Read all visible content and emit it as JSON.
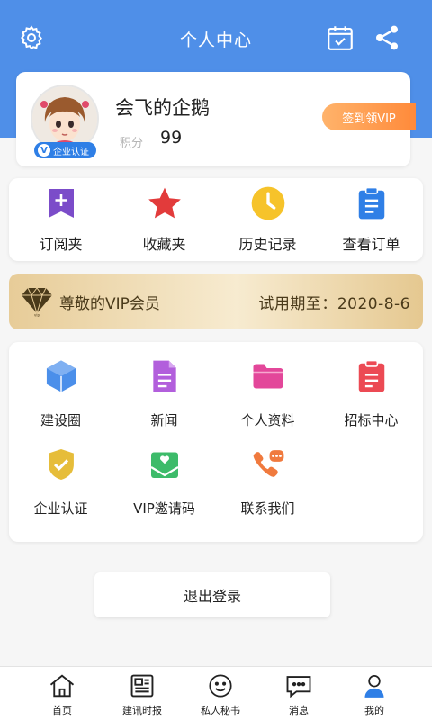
{
  "header": {
    "title": "个人中心"
  },
  "profile": {
    "name": "会飞的企鹅",
    "badge": "企业认证",
    "badge_mark": "V",
    "points_label": "积分",
    "points": "99",
    "signin": "签到领VIP"
  },
  "quick_actions": [
    {
      "label": "订阅夹",
      "icon": "subscribe-icon"
    },
    {
      "label": "收藏夹",
      "icon": "star-icon"
    },
    {
      "label": "历史记录",
      "icon": "clock-icon"
    },
    {
      "label": "查看订单",
      "icon": "clipboard-icon"
    }
  ],
  "vip": {
    "label": "尊敬的VIP会员",
    "expiry": "试用期至：2020-8-6",
    "logo_text": "vip"
  },
  "services": [
    {
      "label": "建设圈",
      "icon": "cube-icon"
    },
    {
      "label": "新闻",
      "icon": "document-icon"
    },
    {
      "label": "个人资料",
      "icon": "folder-icon"
    },
    {
      "label": "招标中心",
      "icon": "clipboard-list-icon"
    },
    {
      "label": "企业认证",
      "icon": "shield-check-icon"
    },
    {
      "label": "VIP邀请码",
      "icon": "mail-heart-icon"
    },
    {
      "label": "联系我们",
      "icon": "phone-chat-icon"
    }
  ],
  "logout": "退出登录",
  "tabs": [
    {
      "label": "首页",
      "icon": "home-icon"
    },
    {
      "label": "建讯时报",
      "icon": "newspaper-icon"
    },
    {
      "label": "私人秘书",
      "icon": "smiley-icon"
    },
    {
      "label": "消息",
      "icon": "message-icon"
    },
    {
      "label": "我的",
      "icon": "person-icon"
    }
  ],
  "colors": {
    "header": "#4f8fe8",
    "accent_orange": "#ff8a3a",
    "vip_gold": "#e7cc98"
  }
}
